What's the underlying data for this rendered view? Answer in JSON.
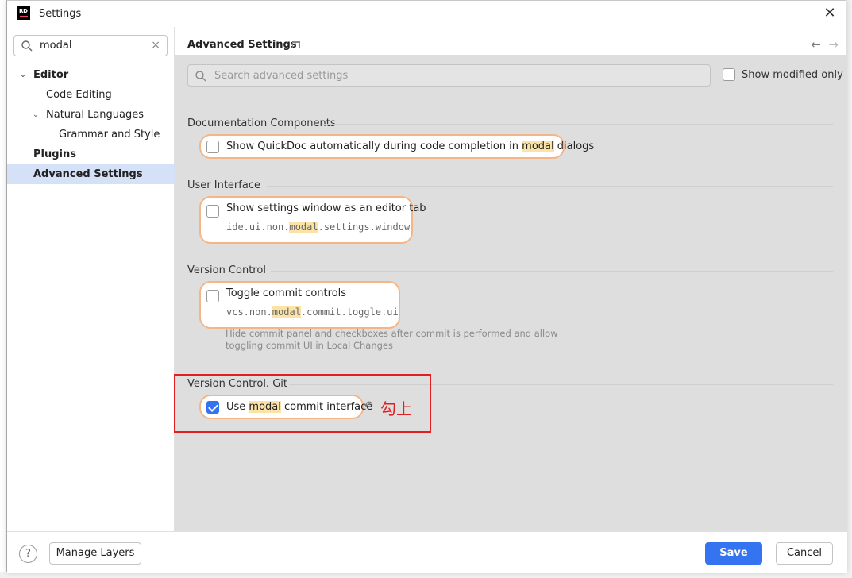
{
  "window": {
    "title": "Settings",
    "logo_text": "RD"
  },
  "sidebar": {
    "search": {
      "value": "modal"
    },
    "items": [
      {
        "label": "Editor"
      },
      {
        "label": "Code Editing"
      },
      {
        "label": "Natural Languages"
      },
      {
        "label": "Grammar and Style"
      },
      {
        "label": "Plugins"
      },
      {
        "label": "Advanced Settings"
      }
    ]
  },
  "content": {
    "title": "Advanced Settings",
    "search_placeholder": "Search advanced settings",
    "show_modified": "Show modified only",
    "groups": [
      {
        "label": "Documentation Components",
        "setting": {
          "before": "Show QuickDoc automatically during code completion in ",
          "highlight": "modal",
          "after": " dialogs",
          "checked": false
        }
      },
      {
        "label": "User Interface",
        "setting": {
          "label": "Show settings window as an editor tab",
          "id_before": "ide.ui.non.",
          "id_highlight": "modal",
          "id_after": ".settings.window",
          "checked": false
        }
      },
      {
        "label": "Version Control",
        "setting": {
          "label": "Toggle commit controls",
          "id_before": "vcs.non.",
          "id_highlight": "modal",
          "id_after": ".commit.toggle.ui",
          "checked": false,
          "description_line1": "Hide commit panel and checkboxes after commit is performed and allow",
          "description_line2": "toggling commit UI in Local Changes"
        }
      },
      {
        "label": "Version Control. Git",
        "setting": {
          "before": "Use ",
          "highlight": "modal",
          "after": " commit interface",
          "checked": true
        }
      }
    ],
    "annotation": "勾上"
  },
  "footer": {
    "help": "?",
    "manage_layers": "Manage Layers",
    "save": "Save",
    "cancel": "Cancel"
  },
  "colors": {
    "accent": "#3574f0",
    "pill_border": "#f5b687",
    "highlight": "#fbe3a8",
    "annotation": "#e02020"
  }
}
